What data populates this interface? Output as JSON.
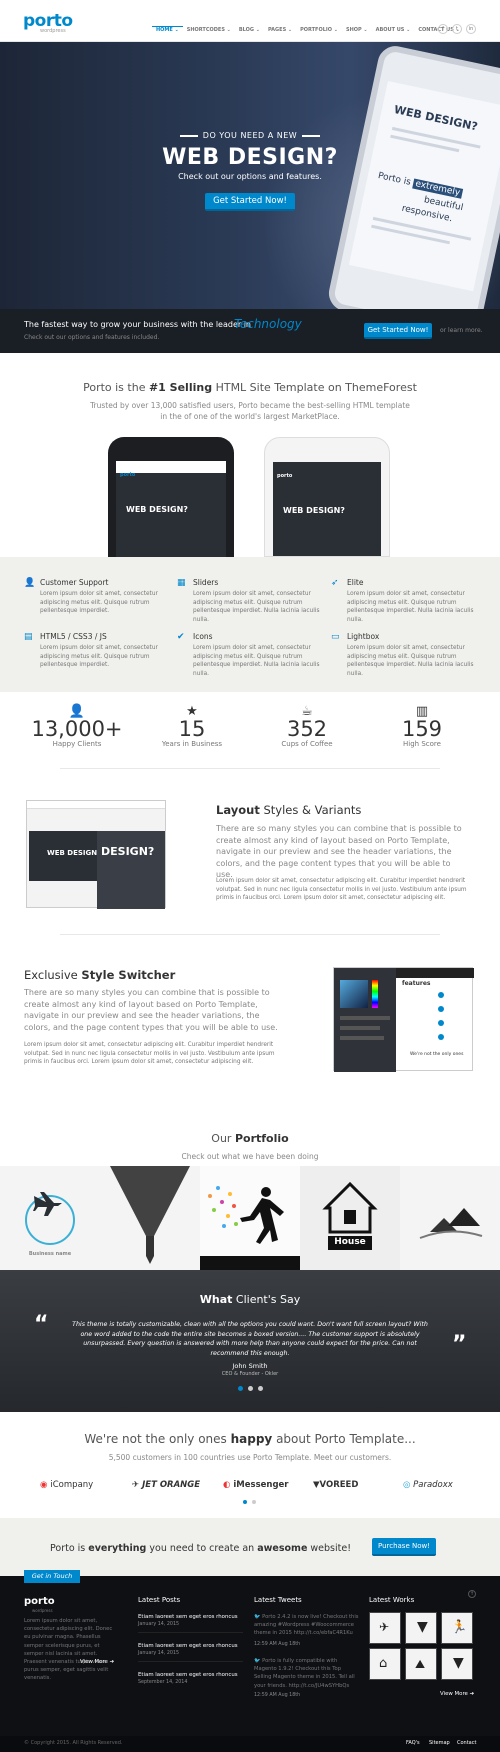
{
  "header": {
    "logo": "porto",
    "logo_sub": "wordpress",
    "nav": [
      "HOME ⌄",
      "SHORTCODES ⌄",
      "BLOG ⌄",
      "PAGES ⌄",
      "PORTFOLIO ⌄",
      "SHOP ⌄",
      "ABOUT US ⌄",
      "CONTACT US ⌄"
    ],
    "social": [
      "f",
      "t",
      "in"
    ]
  },
  "hero": {
    "kicker": "DO YOU NEED A NEW",
    "title": "WEB DESIGN?",
    "subtitle": "Check out our options and features.",
    "button": "Get Started Now!",
    "phone_title": "WEB DESIGN?",
    "phone_word": "extremely",
    "phone_text": "Porto is",
    "phone_text2": "beautiful",
    "phone_text3": "responsive."
  },
  "band": {
    "text": "The fastest way to grow your business with the leader in",
    "highlight": "Technology",
    "sub": "Check out our options and features included.",
    "button": "Get Started Now!",
    "or": "or learn more."
  },
  "intro": {
    "title_a": "Porto is the ",
    "title_b": "#1 Selling",
    "title_c": " HTML Site Template on ThemeForest",
    "sub": "Trusted by over 13,000 satisfied users, Porto became the best-selling HTML template in the of one of the world's largest MarketPlace.",
    "phone_screen": "WEB DESIGN?"
  },
  "features": [
    {
      "icon": "user-icon",
      "glyph": "👤",
      "title": "Customer Support",
      "desc": "Lorem ipsum dolor sit amet, consectetur adipiscing metus elit. Quisque rutrum pellentesque imperdiet."
    },
    {
      "icon": "columns-icon",
      "glyph": "▦",
      "title": "Sliders",
      "desc": "Lorem ipsum dolor sit amet, consectetur adipiscing metus elit. Quisque rutrum pellentesque imperdiet. Nulla lacinia iaculis nulla."
    },
    {
      "icon": "rocket-icon",
      "glyph": "➶",
      "title": "Elite",
      "desc": "Lorem ipsum dolor sit amet, consectetur adipiscing metus elit. Quisque rutrum pellentesque imperdiet. Nulla lacinia iaculis nulla."
    },
    {
      "icon": "file-icon",
      "glyph": "▤",
      "title": "HTML5 / CSS3 / JS",
      "desc": "Lorem ipsum dolor sit amet, consectetur adipiscing metus elit. Quisque rutrum pellentesque imperdiet."
    },
    {
      "icon": "check-icon",
      "glyph": "✔",
      "title": "Icons",
      "desc": "Lorem ipsum dolor sit amet, consectetur adipiscing metus elit. Quisque rutrum pellentesque imperdiet. Nulla lacinia iaculis nulla."
    },
    {
      "icon": "monitor-icon",
      "glyph": "▭",
      "title": "Lightbox",
      "desc": "Lorem ipsum dolor sit amet, consectetur adipiscing metus elit. Quisque rutrum pellentesque imperdiet. Nulla lacinia iaculis nulla."
    }
  ],
  "stats": [
    {
      "icon": "user-icon",
      "glyph": "👤",
      "value": "13,000+",
      "label": "Happy Clients"
    },
    {
      "icon": "star-icon",
      "glyph": "★",
      "value": "15",
      "label": "Years in Business"
    },
    {
      "icon": "coffee-icon",
      "glyph": "☕",
      "value": "352",
      "label": "Cups of Coffee"
    },
    {
      "icon": "bar-chart-icon",
      "glyph": "▥",
      "value": "159",
      "label": "High Score"
    }
  ],
  "layout": {
    "title_a": "Layout",
    "title_b": " Styles & Variants",
    "lead": "There are so many styles you can combine that is possible to create almost any kind of layout based on Porto Template, navigate in our preview and see the header variations, the colors, and the page content types that you will be able to use.",
    "body": "Lorem ipsum dolor sit amet, consectetur adipiscing elit. Curabitur imperdiet hendrerit volutpat. Sed in nunc nec ligula consectetur mollis in vel justo. Vestibulum ante ipsum primis in faucibus orci. Lorem ipsum dolor sit amet, consectetur adipiscing elit.",
    "shot_title": "DESIGN?",
    "shot_title2": "WEB DESIGN?"
  },
  "switcher": {
    "title_a": "Exclusive ",
    "title_b": "Style Switcher",
    "lead": "There are so many styles you can combine that is possible to create almost any kind of layout based on Porto Template, navigate in our preview and see the header variations, the colors, and the page content types that you will be able to use.",
    "body": "Lorem ipsum dolor sit amet, consectetur adipiscing elit. Curabitur imperdiet hendrerit volutpat. Sed in nunc nec ligula consectetur mollis in vel justo. Vestibulum ante ipsum primis in faucibus orci. Lorem ipsum dolor sit amet, consectetur adipiscing elit.",
    "shot_label": "features",
    "shot_caption": "We're not the only ones"
  },
  "portfolio": {
    "title_a": "Our ",
    "title_b": "Portfolio",
    "sub": "Check out what we have been doing",
    "item1_caption": "Business name",
    "item5_caption": "House"
  },
  "testimonial": {
    "title_a": "What",
    "title_b": " Client's Say",
    "quote": "This theme is totally customizable, clean with all the options you could want. Don't want full screen layout? With one word added to the code the entire site becomes a boxed version.... The customer support is absolutely unsurpassed. Every question is answered with more help than anyone could expect for the price. Can not recommend this enough.",
    "name": "John Smith",
    "role": "CEO & Founder - Okler"
  },
  "clients": {
    "title_a": "We're not the only ones ",
    "title_b": "happy",
    "title_c": " about Porto Template...",
    "sub": "5,500 customers in 100 countries use Porto Template. Meet our customers.",
    "logos": [
      "iCompany",
      "JET ORANGE",
      "iMessenger",
      "VOREED",
      "Paradoxx"
    ]
  },
  "cta": {
    "text_a": "Porto is ",
    "text_b": "everything",
    "text_c": " you need to create an ",
    "text_d": "awesome",
    "text_e": " website!",
    "button": "Purchase Now!"
  },
  "footer": {
    "ribbon": "Get in Touch",
    "logo": "porto",
    "logo_sub": "wordpress",
    "about": "Lorem ipsum dolor sit amet, consectetur adipiscing elit. Donec eu pulvinar magna. Phasellus semper scelerisque purus, et semper nisl lacinia sit amet. Praesent venenatis turpis vitae purus semper, eget sagittis velit venenatis.",
    "view_more": "View More ➔",
    "posts_title": "Latest Posts",
    "posts": [
      {
        "title": "Etiam laoreet sem eget eros rhoncus",
        "date": "January 14, 2015"
      },
      {
        "title": "Etiam laoreet sem eget eros rhoncus",
        "date": "January 14, 2015"
      },
      {
        "title": "Etiam laoreet sem eget eros rhoncus",
        "date": "September 14, 2014"
      }
    ],
    "tweets_title": "Latest Tweets",
    "tweet1": "Porto 2.4.2 is now live! Checkout this amazing #Wordpress #Woocommerce theme in 2015 http://t.co/ebfaC4R1Ku",
    "tweet1_date": "12:59 AM Aug 18th",
    "tweet2": "Porto is fully compatible with Magento 1.9.2! Checkout this Top Selling Magento theme in 2015. Tell all your friends. http://t.co/JU4wSYHbQs",
    "tweet2_date": "12:59 AM Aug 18th",
    "works_title": "Latest Works",
    "works_more": "View More ➔",
    "copyright": "© Copyright 2015. All Rights Reserved.",
    "links": [
      "FAQ's",
      "Sitemap",
      "Contact"
    ]
  },
  "colors": {
    "accent": "#0088cc",
    "dark": "#1a1e25",
    "footer": "#0e1014",
    "light": "#f0f0ed"
  }
}
